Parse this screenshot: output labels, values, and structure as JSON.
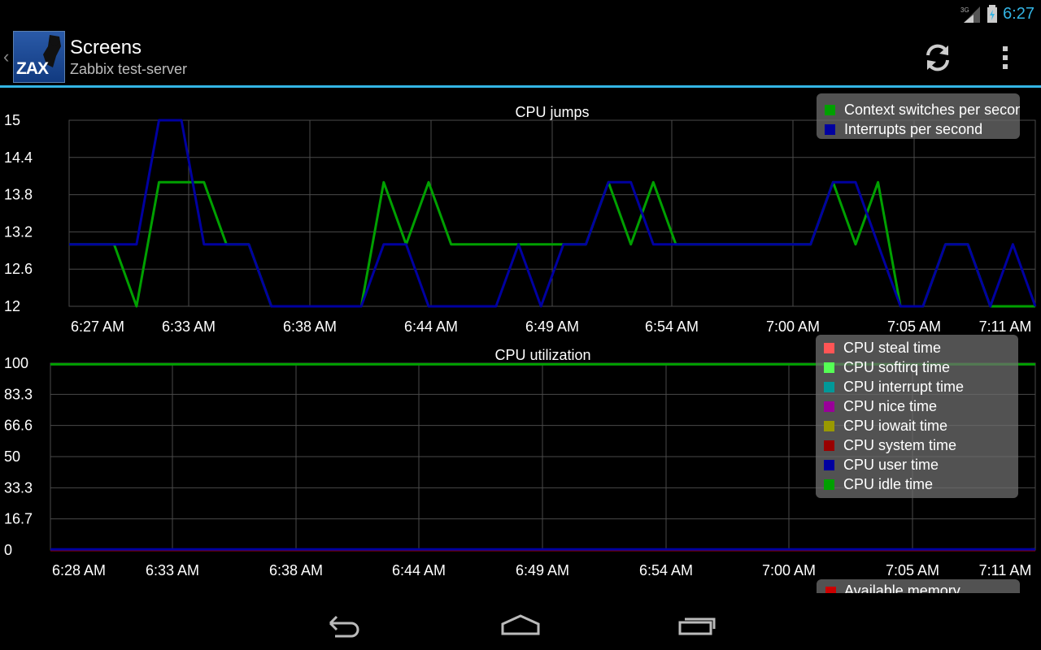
{
  "status_bar": {
    "network": "3G",
    "time": "6:27"
  },
  "action_bar": {
    "logo_text": "ZAX",
    "title": "Screens",
    "subtitle": "Zabbix test-server"
  },
  "charts": [
    {
      "chart_data": {
        "type": "line",
        "title": "CPU jumps",
        "x_tick_labels": [
          "6:27 AM",
          "6:33 AM",
          "6:38 AM",
          "6:44 AM",
          "6:49 AM",
          "6:54 AM",
          "7:00 AM",
          "7:05 AM",
          "7:11 AM"
        ],
        "y_tick_labels": [
          "15",
          "14.4",
          "13.8",
          "13.2",
          "12.6",
          "12"
        ],
        "ylim": [
          12,
          15
        ],
        "series": [
          {
            "name": "Context switches per secon",
            "color": "#00a000",
            "points": [
              [
                0,
                13
              ],
              [
                2,
                13
              ],
              [
                3,
                12
              ],
              [
                4,
                14
              ],
              [
                6,
                14
              ],
              [
                7,
                13
              ],
              [
                8,
                13
              ],
              [
                9,
                12
              ],
              [
                13,
                12
              ],
              [
                14,
                14
              ],
              [
                15,
                13
              ],
              [
                16,
                14
              ],
              [
                17,
                13
              ],
              [
                22,
                13
              ],
              [
                23,
                13
              ],
              [
                24,
                14
              ],
              [
                25,
                13
              ],
              [
                26,
                14
              ],
              [
                27,
                13
              ],
              [
                33,
                13
              ],
              [
                34,
                14
              ],
              [
                35,
                13
              ],
              [
                36,
                14
              ],
              [
                37,
                12
              ],
              [
                38,
                12
              ],
              [
                39,
                13
              ],
              [
                40,
                13
              ],
              [
                41,
                12
              ],
              [
                43,
                12
              ]
            ]
          },
          {
            "name": "Interrupts per second",
            "color": "#0000a0",
            "points": [
              [
                0,
                13
              ],
              [
                3,
                13
              ],
              [
                4,
                15
              ],
              [
                5,
                15
              ],
              [
                6,
                13
              ],
              [
                8,
                13
              ],
              [
                9,
                12
              ],
              [
                13,
                12
              ],
              [
                14,
                13
              ],
              [
                15,
                13
              ],
              [
                16,
                12
              ],
              [
                19,
                12
              ],
              [
                20,
                13
              ],
              [
                21,
                12
              ],
              [
                22,
                13
              ],
              [
                23,
                13
              ],
              [
                24,
                14
              ],
              [
                25,
                14
              ],
              [
                26,
                13
              ],
              [
                33,
                13
              ],
              [
                34,
                14
              ],
              [
                35,
                14
              ],
              [
                36,
                13
              ],
              [
                37,
                12
              ],
              [
                38,
                12
              ],
              [
                39,
                13
              ],
              [
                40,
                13
              ],
              [
                41,
                12
              ],
              [
                42,
                13
              ],
              [
                43,
                12
              ]
            ]
          }
        ],
        "grid": true,
        "legend": "top-right"
      }
    },
    {
      "chart_data": {
        "type": "line",
        "title": "CPU utilization",
        "x_tick_labels": [
          "6:28 AM",
          "6:33 AM",
          "6:38 AM",
          "6:44 AM",
          "6:49 AM",
          "6:54 AM",
          "7:00 AM",
          "7:05 AM",
          "7:11 AM"
        ],
        "y_tick_labels": [
          "100",
          "83.3",
          "66.6",
          "50",
          "33.3",
          "16.7",
          "0"
        ],
        "ylim": [
          0,
          100
        ],
        "series": [
          {
            "name": "CPU steal time",
            "color": "#ff5555",
            "points": [
              [
                0,
                0
              ],
              [
                1,
                0
              ]
            ]
          },
          {
            "name": "CPU softirq time",
            "color": "#55ff55",
            "points": [
              [
                0,
                0
              ],
              [
                1,
                0
              ]
            ]
          },
          {
            "name": "CPU interrupt time",
            "color": "#009999",
            "points": [
              [
                0,
                0
              ],
              [
                1,
                0
              ]
            ]
          },
          {
            "name": "CPU nice time",
            "color": "#990099",
            "points": [
              [
                0,
                0
              ],
              [
                1,
                0
              ]
            ]
          },
          {
            "name": "CPU iowait time",
            "color": "#999900",
            "points": [
              [
                0,
                0
              ],
              [
                0.99,
                0
              ],
              [
                1,
                0.5
              ]
            ]
          },
          {
            "name": "CPU system time",
            "color": "#990000",
            "points": [
              [
                0,
                0
              ],
              [
                1,
                0
              ]
            ]
          },
          {
            "name": "CPU user time",
            "color": "#0000a0",
            "points": [
              [
                0,
                0.4
              ],
              [
                1,
                0.4
              ]
            ]
          },
          {
            "name": "CPU idle time",
            "color": "#00a000",
            "points": [
              [
                0,
                99.4
              ],
              [
                1,
                99.4
              ]
            ]
          }
        ],
        "grid": true,
        "legend": "top-right"
      }
    }
  ],
  "third_chart_legend": {
    "label": "Available memory",
    "color": "#cc0000"
  },
  "nav_bar": {
    "back": "back-icon",
    "home": "home-icon",
    "recents": "recents-icon"
  }
}
